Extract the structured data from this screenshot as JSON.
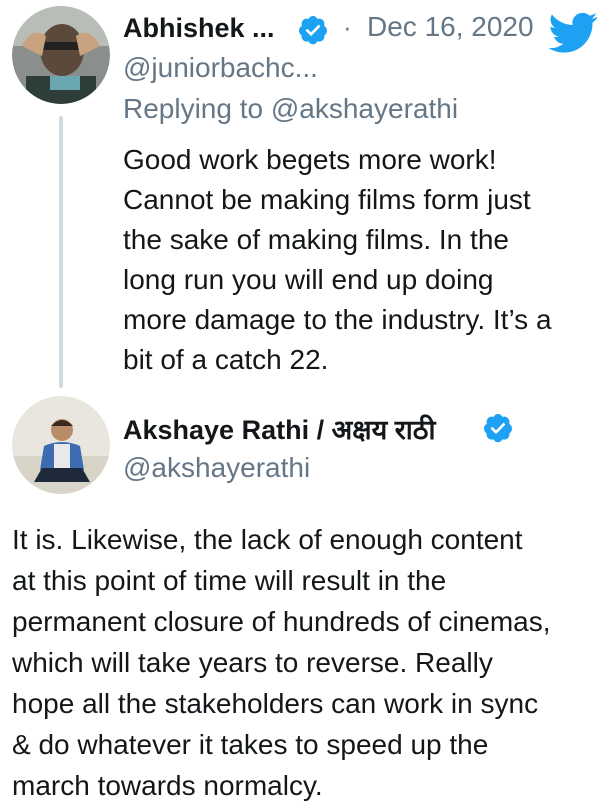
{
  "tweet1": {
    "display_name": "Abhishek ...",
    "handle": "@juniorbachc...",
    "separator": "·",
    "date": "Dec 16, 2020",
    "replying_to": "Replying to @akshayerathi",
    "text": "Good work begets more work!\nCannot be making films form just\nthe sake of making films. In the\nlong run you will end up doing\nmore damage to the industry. It’s a\nbit of a catch 22.",
    "avatar_icon": "user-avatar-photo",
    "verified_icon": "verified-badge-icon"
  },
  "tweet2": {
    "display_name": "Akshaye Rathi / अक्षय राठी",
    "handle": "@akshayerathi",
    "text": "It is. Likewise, the lack of enough content\nat this point of time will result in the\npermanent closure of hundreds of cinemas,\nwhich will take years to reverse. Really\nhope all the stakeholders can work in sync\n& do whatever it takes to speed up the\nmarch towards normalcy.",
    "avatar_icon": "user-avatar-photo",
    "verified_icon": "verified-badge-icon"
  },
  "app_logo_icon": "twitter-bird-icon",
  "colors": {
    "brand_blue": "#1da1f2",
    "muted_text": "#657786",
    "primary_text": "#14171a",
    "thread_line": "#cfd9de"
  }
}
